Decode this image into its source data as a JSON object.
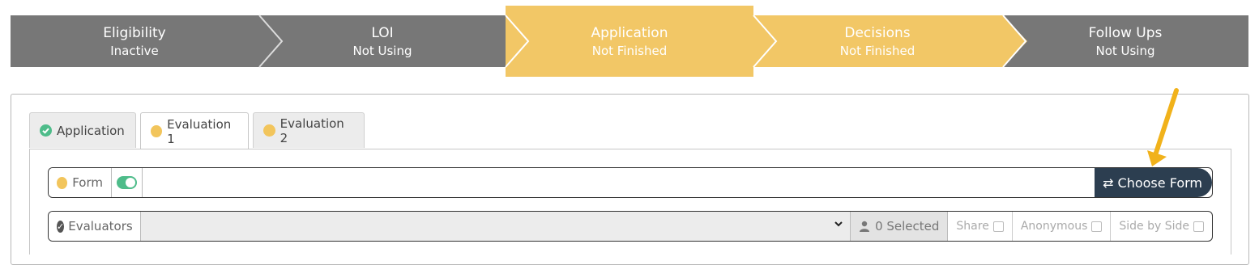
{
  "stepper": {
    "steps": [
      {
        "title": "Eligibility",
        "status": "Inactive"
      },
      {
        "title": "LOI",
        "status": "Not Using"
      },
      {
        "title": "Application",
        "status": "Not Finished"
      },
      {
        "title": "Decisions",
        "status": "Not Finished"
      },
      {
        "title": "Follow Ups",
        "status": "Not Using"
      }
    ],
    "colors": {
      "inactive": "#777777",
      "active": "#f2c766"
    }
  },
  "tabs": [
    {
      "label": "Application",
      "status": "complete"
    },
    {
      "label": "Evaluation 1",
      "status": "in-progress"
    },
    {
      "label": "Evaluation 2",
      "status": "in-progress"
    }
  ],
  "form_row": {
    "label": "Form",
    "toggle_on": true,
    "value": "",
    "choose_button": "Choose Form"
  },
  "evaluators_row": {
    "label": "Evaluators",
    "selected": "",
    "selected_count": "0 Selected",
    "options": {
      "share": "Share",
      "anonymous": "Anonymous",
      "side_by_side": "Side by Side"
    }
  },
  "icons": {
    "choose": "swap-arrows-icon",
    "evaluators": "check-circle-icon",
    "count": "user-icon"
  },
  "accent_colors": {
    "green": "#4ebc8a",
    "yellow": "#f2c55c",
    "dark": "#2c3e50",
    "arrow": "#f1b21b"
  }
}
